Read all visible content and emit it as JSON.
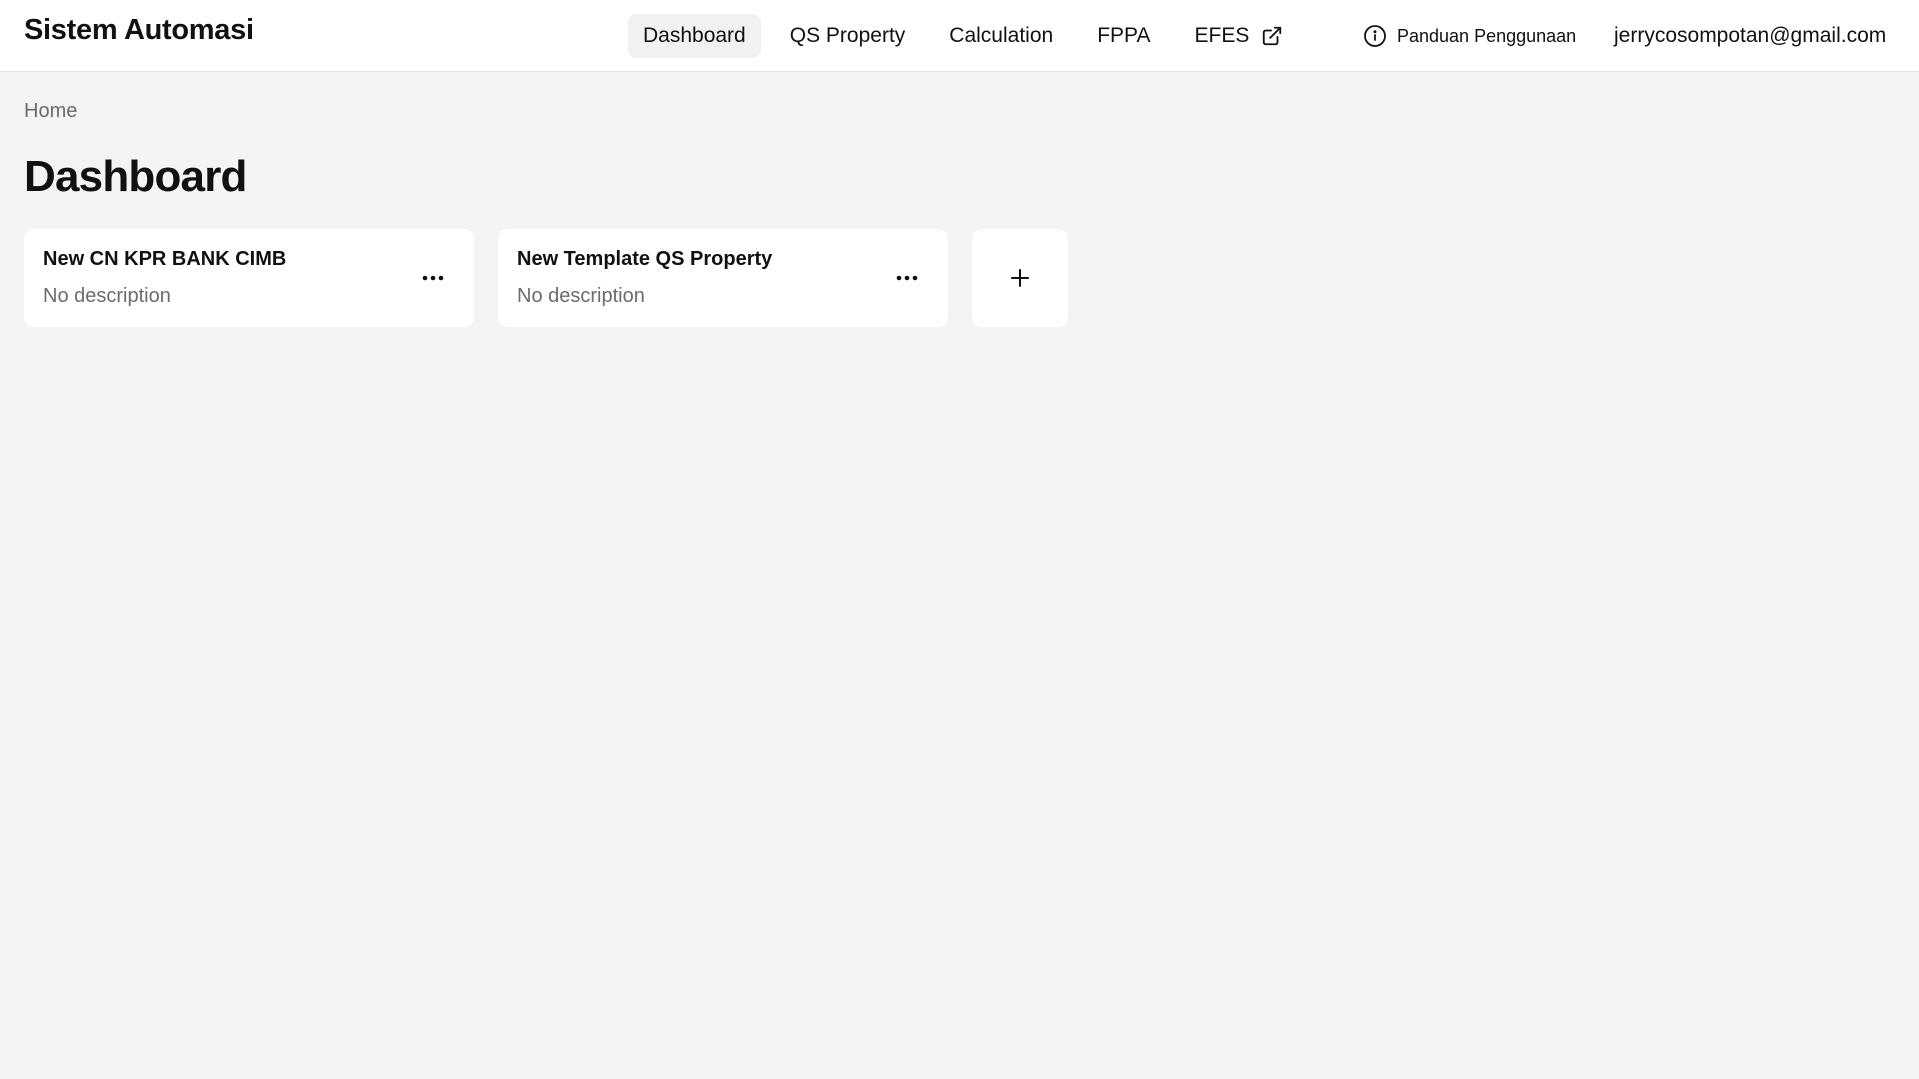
{
  "header": {
    "brand": "Sistem Automasi",
    "nav": [
      {
        "label": "Dashboard",
        "active": true
      },
      {
        "label": "QS Property",
        "active": false
      },
      {
        "label": "Calculation",
        "active": false
      },
      {
        "label": "FPPA",
        "active": false
      },
      {
        "label": "EFES",
        "active": false,
        "icon": "external-link-icon"
      }
    ],
    "help_label": "Panduan Penggunaan",
    "help_icon": "info-icon",
    "user_email": "jerrycosompotan@gmail.com"
  },
  "breadcrumb": "Home",
  "page_title": "Dashboard",
  "cards": [
    {
      "title": "New CN KPR BANK CIMB",
      "description": "No description",
      "menu_icon": "more-horizontal-icon"
    },
    {
      "title": "New Template QS Property",
      "description": "No description",
      "menu_icon": "more-horizontal-icon"
    }
  ],
  "add_card_icon": "plus-icon",
  "colors": {
    "background": "#f4f4f4",
    "surface": "#ffffff",
    "text": "#111111",
    "muted_text": "#6b6b6b",
    "active_nav_bg": "#f1f1f1"
  }
}
